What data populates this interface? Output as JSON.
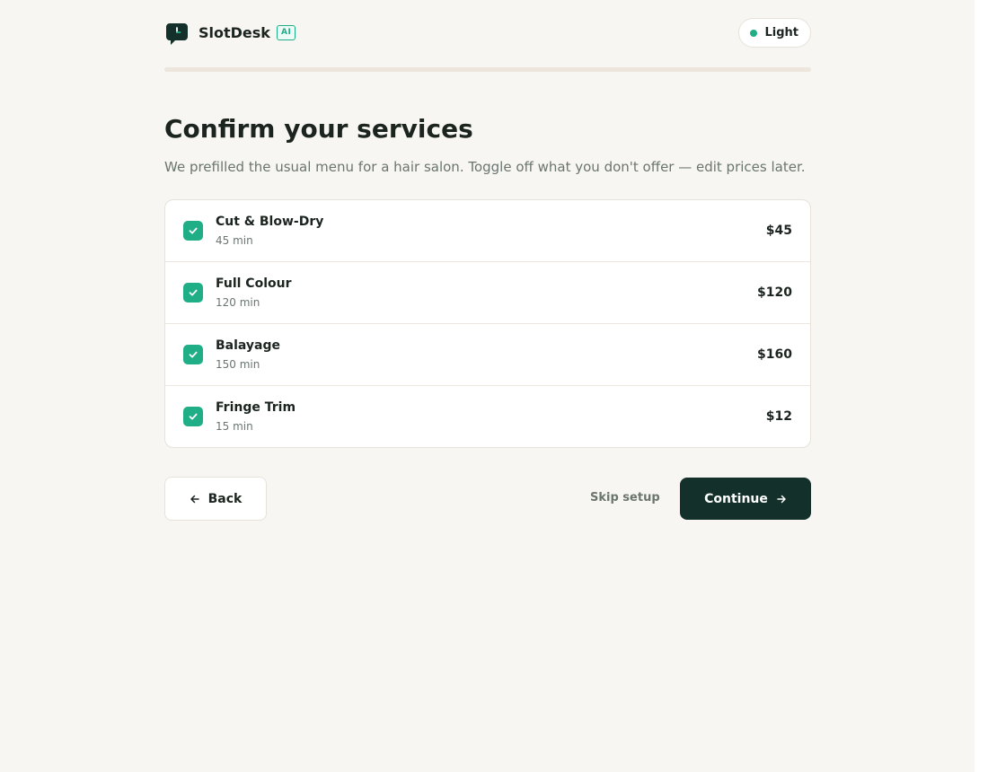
{
  "brand": {
    "name": "SlotDesk",
    "badge": "AI"
  },
  "theme_toggle": {
    "label": "Light"
  },
  "onboarding": {
    "progress_percent": 0
  },
  "page": {
    "title": "Confirm your services",
    "subtitle": "We prefilled the usual menu for a hair salon. Toggle off what you don't offer — edit prices later."
  },
  "services": [
    {
      "name": "Cut & Blow-Dry",
      "duration": "45 min",
      "price": "$45",
      "checked": true
    },
    {
      "name": "Full Colour",
      "duration": "120 min",
      "price": "$120",
      "checked": true
    },
    {
      "name": "Balayage",
      "duration": "150 min",
      "price": "$160",
      "checked": true
    },
    {
      "name": "Fringe Trim",
      "duration": "15 min",
      "price": "$12",
      "checked": true
    }
  ],
  "actions": {
    "back_label": "Back",
    "skip_label": "Skip setup",
    "continue_label": "Continue"
  },
  "colors": {
    "accent": "#1fae86",
    "primary_button": "#14302a",
    "background": "#f8f6f2"
  }
}
